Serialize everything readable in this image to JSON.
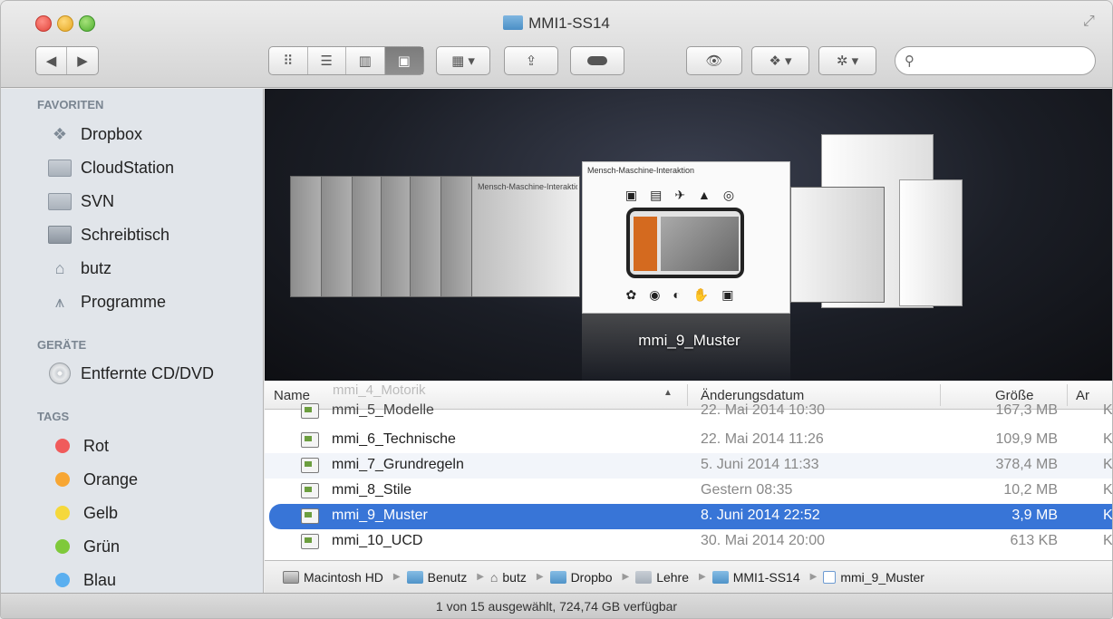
{
  "window": {
    "title": "MMI1-SS14"
  },
  "toolbar": {
    "back_icon": "chevron-left-icon",
    "forward_icon": "chevron-right-icon",
    "view_modes": [
      "icon-view",
      "list-view",
      "column-view",
      "coverflow-view"
    ],
    "active_view": "coverflow-view",
    "arrange_icon": "arrange-grid-icon",
    "share_icon": "share-icon",
    "tag_icon": "tag-icon",
    "quicklook_icon": "eye-icon",
    "dropbox_icon": "dropbox-icon",
    "action_icon": "gear-icon",
    "search_placeholder": ""
  },
  "sidebar": {
    "favorites_header": "FAVORITEN",
    "favorites": [
      {
        "label": "Dropbox",
        "icon": "dropbox-icon"
      },
      {
        "label": "CloudStation",
        "icon": "folder-icon"
      },
      {
        "label": "SVN",
        "icon": "folder-icon"
      },
      {
        "label": "Schreibtisch",
        "icon": "desktop-icon"
      },
      {
        "label": "butz",
        "icon": "home-icon"
      },
      {
        "label": "Programme",
        "icon": "applications-icon"
      }
    ],
    "devices_header": "GERÄTE",
    "devices": [
      {
        "label": "Entfernte CD/DVD",
        "icon": "disc-icon"
      }
    ],
    "tags_header": "TAGS",
    "tags": [
      {
        "label": "Rot",
        "color": "#f05b5b"
      },
      {
        "label": "Orange",
        "color": "#f7a633"
      },
      {
        "label": "Gelb",
        "color": "#f5d83b"
      },
      {
        "label": "Grün",
        "color": "#7fc93b"
      },
      {
        "label": "Blau",
        "color": "#5aaff0"
      }
    ]
  },
  "coverflow": {
    "doc_title": "Mensch-Maschine-Interaktion",
    "side_doc_label": "Mensch-Maschine-Interaktion",
    "caption": "mmi_9_Muster"
  },
  "list": {
    "columns": {
      "name": "Name",
      "date": "Änderungsdatum",
      "size": "Größe",
      "kind": "Ar"
    },
    "ghost_row": "mmi_4_Motorik",
    "rows": [
      {
        "name": "mmi_5_Modelle",
        "date": "22. Mai 2014 10:30",
        "size": "167,3 MB",
        "kind": "Ko"
      },
      {
        "name": "mmi_6_Technische",
        "date": "22. Mai 2014 11:26",
        "size": "109,9 MB",
        "kind": "Ko"
      },
      {
        "name": "mmi_7_Grundregeln",
        "date": "5. Juni 2014 11:33",
        "size": "378,4 MB",
        "kind": "Ko"
      },
      {
        "name": "mmi_8_Stile",
        "date": "Gestern 08:35",
        "size": "10,2 MB",
        "kind": "Ko"
      },
      {
        "name": "mmi_9_Muster",
        "date": "8. Juni 2014 22:52",
        "size": "3,9 MB",
        "kind": "Ko"
      },
      {
        "name": "mmi_10_UCD",
        "date": "30. Mai 2014 20:00",
        "size": "613 KB",
        "kind": "Ko"
      }
    ],
    "selected_index": 4
  },
  "pathbar": {
    "crumbs": [
      "Macintosh HD",
      "Benutz",
      "butz",
      "Dropbo",
      "Lehre",
      "MMI1-SS14",
      "mmi_9_Muster"
    ]
  },
  "status": {
    "text": "1 von 15 ausgewählt, 724,74 GB verfügbar"
  }
}
